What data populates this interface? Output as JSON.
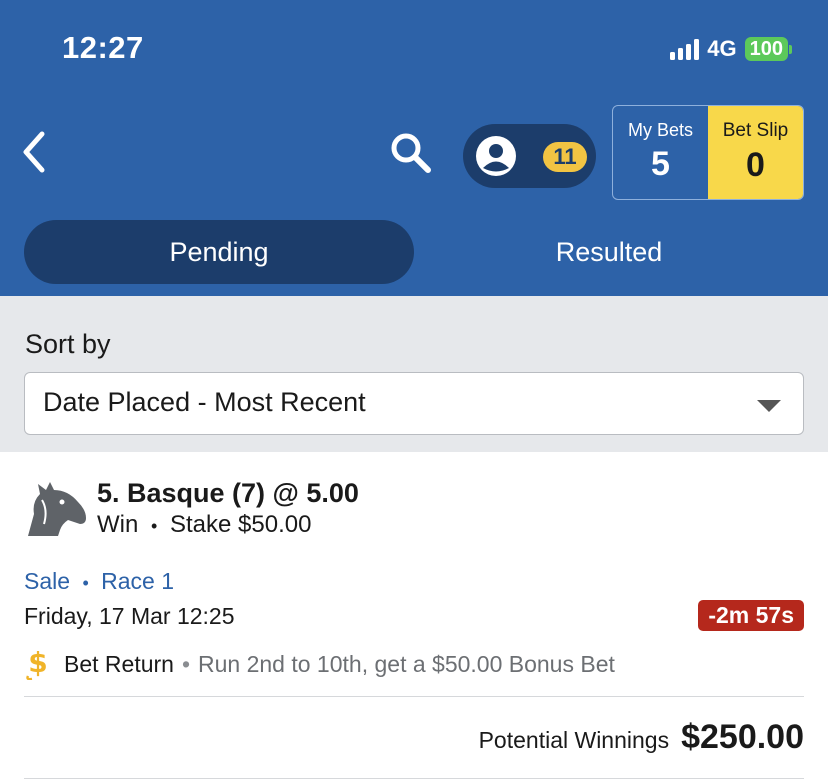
{
  "status_bar": {
    "time": "12:27",
    "network": "4G",
    "battery": "100"
  },
  "header": {
    "account_badge": "11",
    "my_bets": {
      "label": "My Bets",
      "count": "5"
    },
    "bet_slip": {
      "label": "Bet Slip",
      "count": "0"
    },
    "tabs": [
      {
        "label": "Pending",
        "active": true
      },
      {
        "label": "Resulted",
        "active": false
      }
    ]
  },
  "sort": {
    "label": "Sort by",
    "selected": "Date Placed - Most Recent"
  },
  "bet": {
    "title": "5. Basque (7) @ 5.00",
    "bet_type": "Win",
    "sep": "•",
    "stake": "Stake $50.00",
    "venue": "Sale",
    "race": "Race 1",
    "date": "Friday, 17 Mar 12:25",
    "countdown": "-2m 57s",
    "promo_title": "Bet Return",
    "promo_desc": "Run 2nd to 10th, get a $50.00 Bonus Bet",
    "winnings_label": "Potential Winnings",
    "winnings_value": "$250.00"
  },
  "colors": {
    "header_bg": "#2d62a8",
    "active_tab": "#1c3d6b",
    "bet_slip_bg": "#f8d84a",
    "badge": "#f2c443",
    "countdown_bg": "#b5281c",
    "link": "#2d62a8"
  },
  "icons": [
    "back-chevron-icon",
    "search-icon",
    "user-avatar-icon",
    "horse-head-icon",
    "dollar-return-icon",
    "dropdown-caret-icon"
  ]
}
